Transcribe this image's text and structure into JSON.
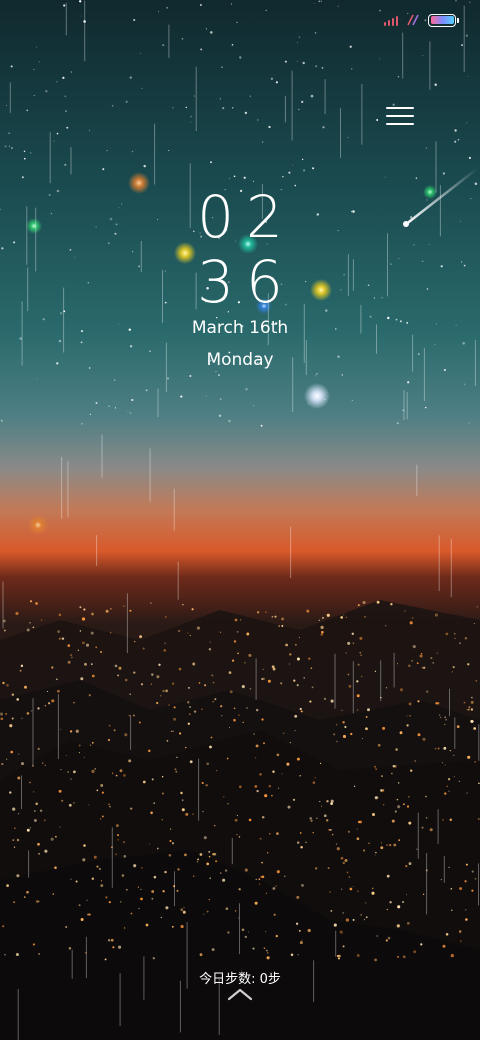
{
  "status_bar": {
    "signal_icon": "signal-icon",
    "network_icon": "network-activity-icon",
    "battery_icon": "battery-icon",
    "battery_colors": [
      "#ff6b9a",
      "#7f8cff",
      "#55d0ff"
    ]
  },
  "menu": {
    "icon": "hamburger-menu-icon"
  },
  "clock": {
    "hours": "02",
    "minutes": "36"
  },
  "date": {
    "date": "March 16th",
    "weekday": "Monday"
  },
  "footer": {
    "steps": "今日步数: 0步",
    "unlock_icon": "chevron-up-icon"
  },
  "wallpaper": {
    "description_colors": {
      "sky_top": "#16383c",
      "sky_mid": "#2c6c70",
      "horizon": "#d2542a",
      "ground": "#120e0c"
    }
  }
}
